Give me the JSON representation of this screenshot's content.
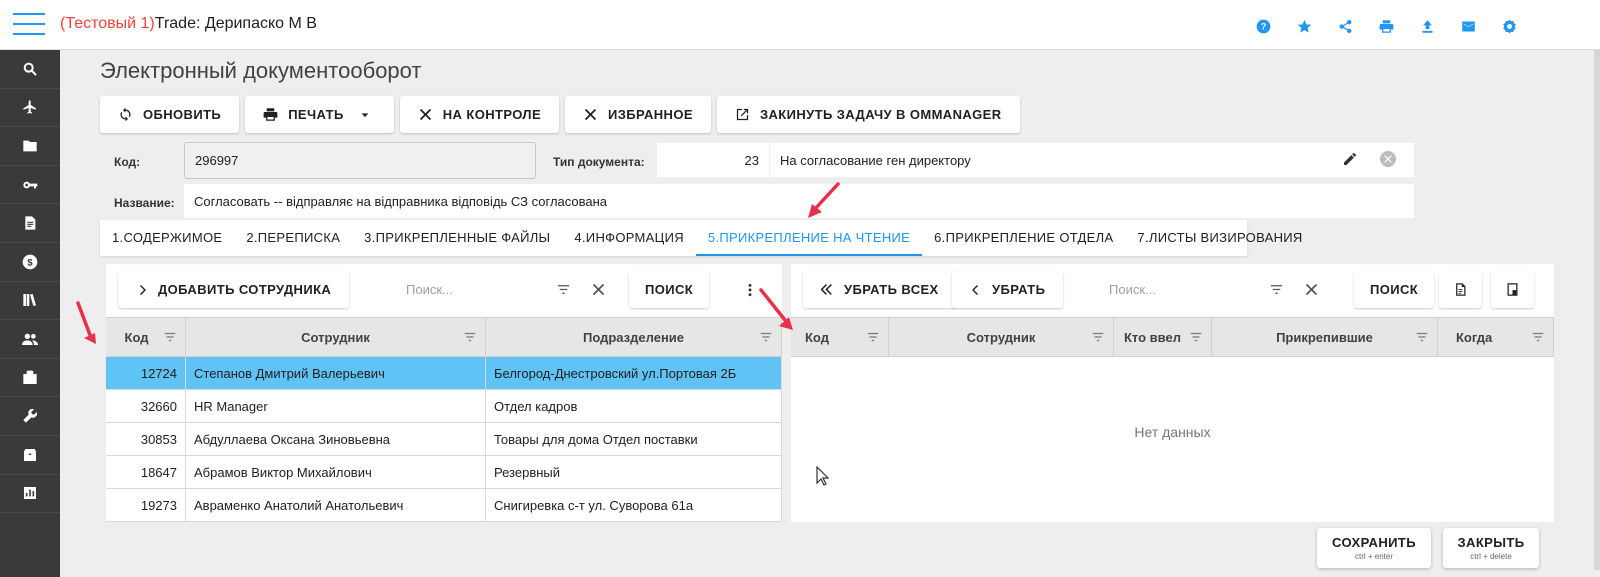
{
  "header": {
    "title_prefix": "(Тестовый 1)",
    "title_main": "Trade: Дерипаско М В",
    "icons": [
      "help-icon",
      "star-icon",
      "share-icon",
      "print-icon",
      "upload-icon",
      "mail-icon",
      "settings-icon"
    ]
  },
  "sidebar": {
    "items": [
      "search-icon",
      "plane-icon",
      "folder-icon",
      "key-icon",
      "document-icon",
      "dollar-icon",
      "library-icon",
      "people-icon",
      "briefcase-icon",
      "wrench-icon",
      "package-icon",
      "chart-icon"
    ]
  },
  "page": {
    "title": "Электронный документооборот"
  },
  "toolbar": {
    "refresh": "ОБНОВИТЬ",
    "print": "ПЕЧАТЬ",
    "on_control": "НА КОНТРОЛЕ",
    "favorite": "ИЗБРАННОЕ",
    "send_task": "ЗАКИНУТЬ ЗАДАЧУ В OMMANAGER"
  },
  "form": {
    "code_label": "Код:",
    "code_value": "296997",
    "doctype_label": "Тип документа:",
    "doctype_num": "23",
    "doctype_name": "На согласование ген директору",
    "name_label": "Название:",
    "name_value": "Согласовать -- відправляє на відправника відповідь СЗ согласована"
  },
  "tabs": [
    {
      "label": "1.СОДЕРЖИМОЕ"
    },
    {
      "label": "2.ПЕРЕПИСКА"
    },
    {
      "label": "3.ПРИКРЕПЛЕННЫЕ ФАЙЛЫ"
    },
    {
      "label": "4.ИНФОРМАЦИЯ"
    },
    {
      "label": "5.ПРИКРЕПЛЕНИЕ НА ЧТЕНИЕ"
    },
    {
      "label": "6.ПРИКРЕПЛЕНИЕ ОТДЕЛА"
    },
    {
      "label": "7.ЛИСТЫ ВИЗИРОВАНИЯ"
    }
  ],
  "left_panel": {
    "add_button": "ДОБАВИТЬ СОТРУДНИКА",
    "search_placeholder": "Поиск...",
    "search_button": "ПОИСК",
    "columns": [
      "Код",
      "Сотрудник",
      "Подразделение"
    ],
    "rows": [
      {
        "code": "12724",
        "employee": "Степанов Дмитрий Валерьевич",
        "department": "Белгород-Днестровский ул.Портовая 2Б"
      },
      {
        "code": "32660",
        "employee": "HR Manager",
        "department": "Отдел кадров"
      },
      {
        "code": "30853",
        "employee": "Абдуллаева Оксана Зиновьевна",
        "department": "Товары для дома Отдел поставки"
      },
      {
        "code": "18647",
        "employee": "Абрамов Виктор Михайлович",
        "department": "Резервный"
      },
      {
        "code": "19273",
        "employee": "Авраменко Анатолий Анатольевич",
        "department": "Снигиревка с-т ул. Суворова 61а"
      }
    ]
  },
  "right_panel": {
    "remove_all": "УБРАТЬ ВСЕХ",
    "remove": "УБРАТЬ",
    "search_placeholder": "Поиск...",
    "search_button": "ПОИСК",
    "columns": [
      "Код",
      "Сотрудник",
      "Кто ввел",
      "Прикрепившие",
      "Когда"
    ],
    "no_data": "Нет данных"
  },
  "footer": {
    "save": "СОХРАНИТЬ",
    "save_hint": "ctrl + enter",
    "close": "ЗАКРЫТЬ",
    "close_hint": "ctrl + delete"
  },
  "colors": {
    "accent": "#2196f3",
    "test_label": "#f44336",
    "selected_row": "#5fc3f5",
    "sidebar": "#3a3a3a",
    "annotation_arrow": "#e8304a"
  }
}
